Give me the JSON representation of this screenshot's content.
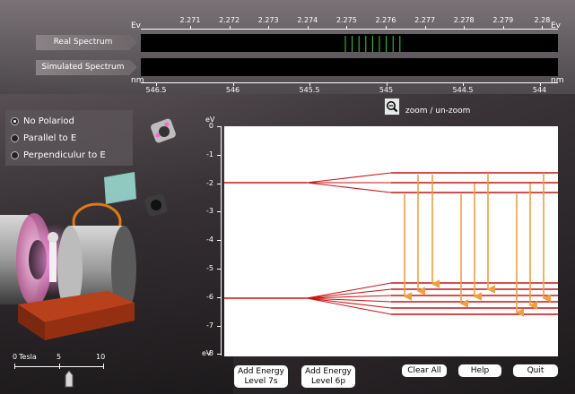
{
  "spectrum": {
    "ev_unit": "Ev",
    "nm_unit": "nm",
    "ev_ticks": [
      "2.271",
      "2.272",
      "2.273",
      "2.274",
      "2.275",
      "2.276",
      "2.277",
      "2.278",
      "2.279",
      "2.28"
    ],
    "nm_ticks": [
      "546.5",
      "546",
      "545.5",
      "545",
      "544.5",
      "544"
    ],
    "real_label": "Real Spectrum",
    "simulated_label": "Simulated Spectrum",
    "line_color": "#35d035",
    "zoom_label": "zoom / un-zoom"
  },
  "polarizer": {
    "options": [
      {
        "label": "No Polariod",
        "selected": true
      },
      {
        "label": "Parallel to E",
        "selected": false
      },
      {
        "label": "Perpendiculur to E",
        "selected": false
      }
    ]
  },
  "magnet_slider": {
    "unit_label": "Tesla",
    "tick_labels": [
      "0",
      "5",
      "10"
    ],
    "value": 5,
    "max": 10
  },
  "energy_plot": {
    "y_unit_top": "eV",
    "y_unit_bottom": "eV",
    "y_ticks": [
      "0",
      "-1",
      "-2",
      "-3",
      "-4",
      "-5",
      "-6",
      "-7",
      "-8"
    ],
    "level_color": "#cc1111",
    "transition_color": "#f0a040"
  },
  "buttons": {
    "add_7s": "Add Energy Level 7s",
    "add_6p": "Add Energy Level 6p",
    "clear_all": "Clear All",
    "help": "Help",
    "quit": "Quit"
  }
}
